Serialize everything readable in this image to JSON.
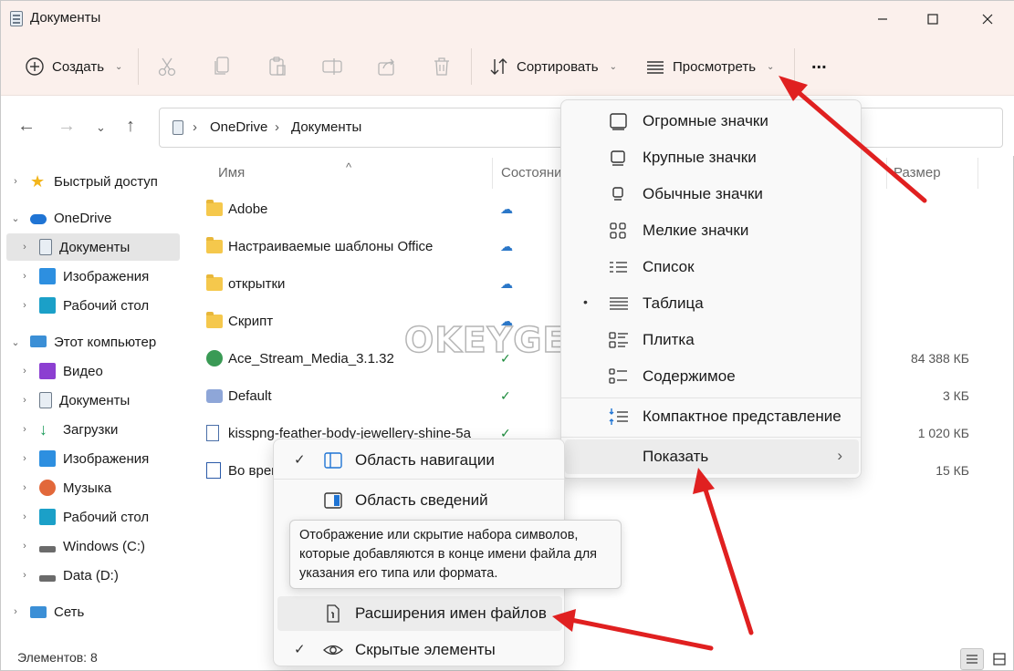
{
  "window": {
    "title": "Документы"
  },
  "toolbar": {
    "new_label": "Создать",
    "sort_label": "Сортировать",
    "view_label": "Просмотреть",
    "more_label": "..."
  },
  "address": {
    "segments": [
      "OneDrive",
      "Документы"
    ]
  },
  "sidebar": {
    "items": [
      {
        "label": "Быстрый доступ",
        "icon": "star-icon"
      },
      {
        "label": "OneDrive",
        "icon": "cloud-icon"
      },
      {
        "label": "Документы",
        "icon": "document-icon"
      },
      {
        "label": "Изображения",
        "icon": "images-icon"
      },
      {
        "label": "Рабочий стол",
        "icon": "desktop-icon"
      },
      {
        "label": "Этот компьютер",
        "icon": "computer-icon"
      },
      {
        "label": "Видео",
        "icon": "video-icon"
      },
      {
        "label": "Документы",
        "icon": "document-icon"
      },
      {
        "label": "Загрузки",
        "icon": "download-icon"
      },
      {
        "label": "Изображения",
        "icon": "images-icon"
      },
      {
        "label": "Музыка",
        "icon": "music-icon"
      },
      {
        "label": "Рабочий стол",
        "icon": "desktop-icon"
      },
      {
        "label": "Windows (C:)",
        "icon": "drive-icon"
      },
      {
        "label": "Data (D:)",
        "icon": "drive-icon"
      },
      {
        "label": "Сеть",
        "icon": "network-icon"
      }
    ]
  },
  "columns": {
    "name": "Имя",
    "status": "Состояни",
    "size": "Размер"
  },
  "files": [
    {
      "name": "Adobe",
      "size": ""
    },
    {
      "name": "Настраиваемые шаблоны Office",
      "size": ""
    },
    {
      "name": "открытки",
      "size": ""
    },
    {
      "name": "Скрипт",
      "size": ""
    },
    {
      "name": "Ace_Stream_Media_3.1.32",
      "size": "84 388 КБ"
    },
    {
      "name": "Default",
      "size": "3 КБ"
    },
    {
      "name": "kisspng-feather-body-jewellery-shine-5a",
      "size": "1 020 КБ"
    },
    {
      "name": "Во врем",
      "size": "15 КБ"
    }
  ],
  "watermark": "OKEYGEEK",
  "view_menu": {
    "items": [
      "Огромные значки",
      "Крупные значки",
      "Обычные значки",
      "Мелкие значки",
      "Список",
      "Таблица",
      "Плитка",
      "Содержимое",
      "Компактное представление",
      "Показать"
    ],
    "selected_bullet": "•"
  },
  "show_menu": {
    "items": [
      "Область навигации",
      "Область сведений",
      "Расширения имен файлов",
      "Скрытые элементы"
    ],
    "check": "✓"
  },
  "tooltip": "Отображение или скрытие набора символов, которые добавляются в конце имени файла для указания его типа или формата.",
  "status": {
    "items_count": "Элементов: 8"
  },
  "colors": {
    "accent_red": "#e02020",
    "toolbar_bg": "#fbf0ec",
    "cloud_blue": "#2b77c8",
    "ok_green": "#1a8a3a"
  }
}
